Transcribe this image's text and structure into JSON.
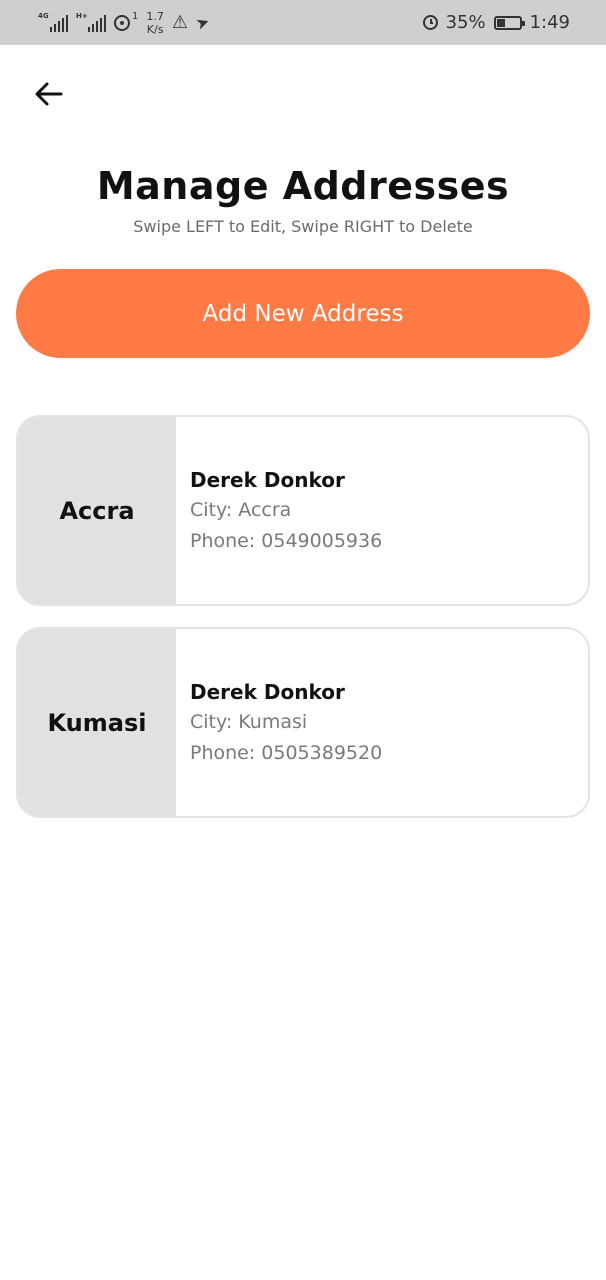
{
  "status_bar": {
    "network1": "4G",
    "network2": "H+",
    "hotspot_count": "1",
    "speed_value": "1.7",
    "speed_unit": "K/s",
    "battery_percent": "35%",
    "time": "1:49",
    "icons": [
      "signal-icon",
      "signal-icon",
      "hotspot-icon",
      "warning-icon",
      "telegram-icon",
      "alarm-icon",
      "battery-icon"
    ]
  },
  "header": {
    "back_icon": "arrow-left-icon",
    "title": "Manage Addresses",
    "subtitle": "Swipe LEFT to Edit, Swipe RIGHT to Delete"
  },
  "add_button": {
    "label": "Add New Address",
    "color": "#ff7a45"
  },
  "addresses": [
    {
      "city_label": "Accra",
      "name": "Derek Donkor",
      "city_line": "City: Accra",
      "phone_line": "Phone: 0549005936"
    },
    {
      "city_label": "Kumasi",
      "name": "Derek Donkor",
      "city_line": "City: Kumasi",
      "phone_line": "Phone: 0505389520"
    }
  ]
}
